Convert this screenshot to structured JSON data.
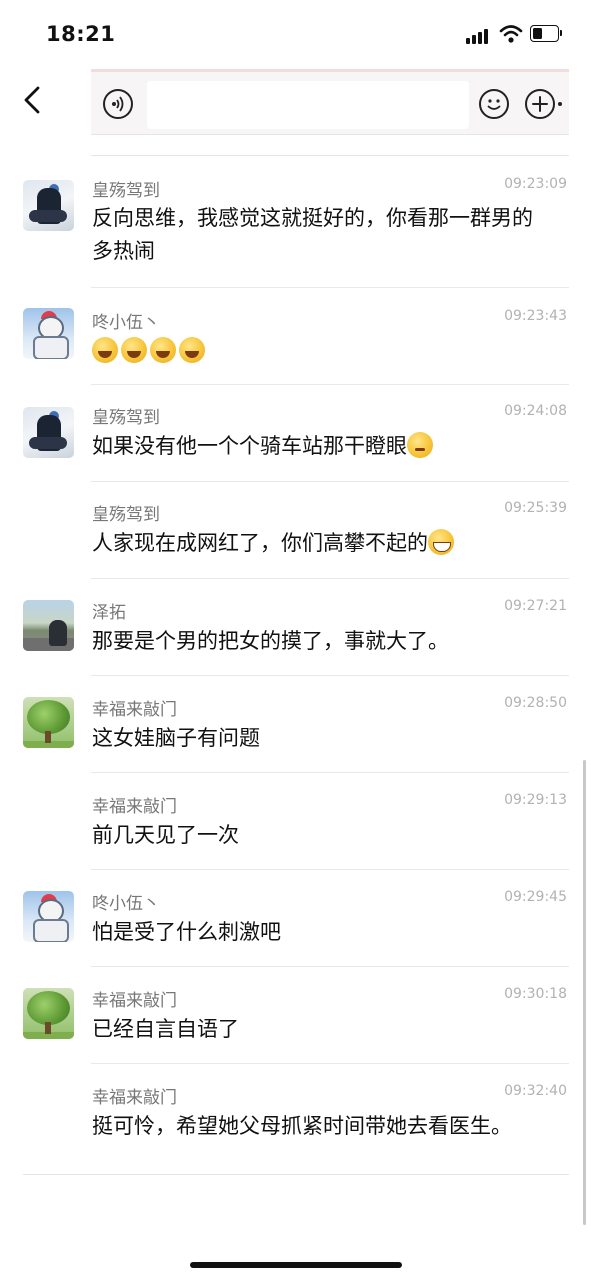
{
  "status_bar": {
    "time": "18:21"
  },
  "messages": [
    {
      "sender": "皇殇驾到",
      "time": "09:23:09",
      "text": "反向思维，我感觉这就挺好的，你看那一群男的多热闹",
      "avatar": "knight-avatar"
    },
    {
      "sender": "咚小伍丶",
      "time": "09:23:43",
      "text": "",
      "emojis": [
        "laugh-cry-emoji",
        "laugh-cry-emoji",
        "laugh-cry-emoji",
        "laugh-cry-emoji"
      ],
      "avatar": "robot-avatar"
    },
    {
      "sender": "皇殇驾到",
      "time": "09:24:08",
      "text": "如果没有他一个个骑车站那干瞪眼",
      "emojis": [
        "thinking-emoji"
      ],
      "avatar": "knight-avatar"
    },
    {
      "sender": "皇殇驾到",
      "time": "09:25:39",
      "text": "人家现在成网红了，你们高攀不起的",
      "emojis": [
        "grin-emoji"
      ],
      "avatar": null
    },
    {
      "sender": "泽拓",
      "time": "09:27:21",
      "text": "那要是个男的把女的摸了，事就大了。",
      "avatar": "road-avatar"
    },
    {
      "sender": "幸福来敲门",
      "time": "09:28:50",
      "text": "这女娃脑子有问题",
      "avatar": "tree-avatar"
    },
    {
      "sender": "幸福来敲门",
      "time": "09:29:13",
      "text": "前几天见了一次",
      "avatar": null
    },
    {
      "sender": "咚小伍丶",
      "time": "09:29:45",
      "text": "怕是受了什么刺激吧",
      "avatar": "robot-avatar"
    },
    {
      "sender": "幸福来敲门",
      "time": "09:30:18",
      "text": "已经自言自语了",
      "avatar": "tree-avatar"
    },
    {
      "sender": "幸福来敲门",
      "time": "09:32:40",
      "text": "挺可怜，希望她父母抓紧时间带她去看医生。",
      "avatar": null
    }
  ],
  "colors": {
    "sender": "#777777",
    "time": "#b2b2b2",
    "text": "#111111",
    "separator": "#e8e8e8"
  }
}
